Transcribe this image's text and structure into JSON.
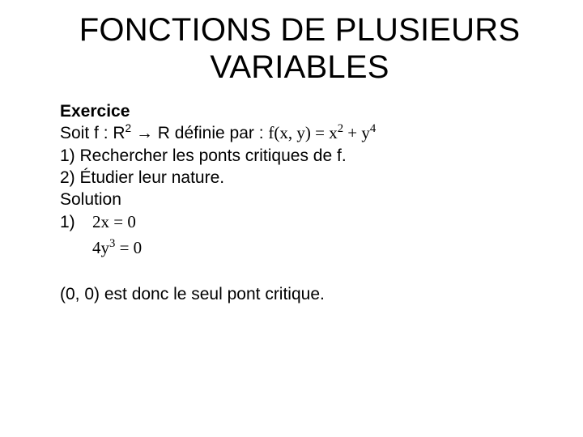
{
  "title": "FONCTIONS DE PLUSIEURS VARIABLES",
  "exercice_label": "Exercice",
  "line_soit_prefix": "Soit f : R",
  "line_soit_sup": "2",
  "line_soit_mid": " → R définie par :   ",
  "fdef_lhs": "f(x, y)",
  "fdef_eq": " = ",
  "fdef_t1_base": "x",
  "fdef_t1_exp": "2",
  "fdef_plus": " + ",
  "fdef_t2_base": "y",
  "fdef_t2_exp": "4",
  "q1": "1) Rechercher les ponts critiques de f.",
  "q2": "2) Étudier leur nature.",
  "solution_label": "Solution",
  "sol1_label": "1)",
  "eq1_lhs": "2x",
  "eq1_eq": " = 0",
  "eq2_coeff": "4",
  "eq2_base": "y",
  "eq2_exp": "3",
  "eq2_eq": " = 0",
  "conclusion": "(0, 0) est donc le seul pont critique."
}
